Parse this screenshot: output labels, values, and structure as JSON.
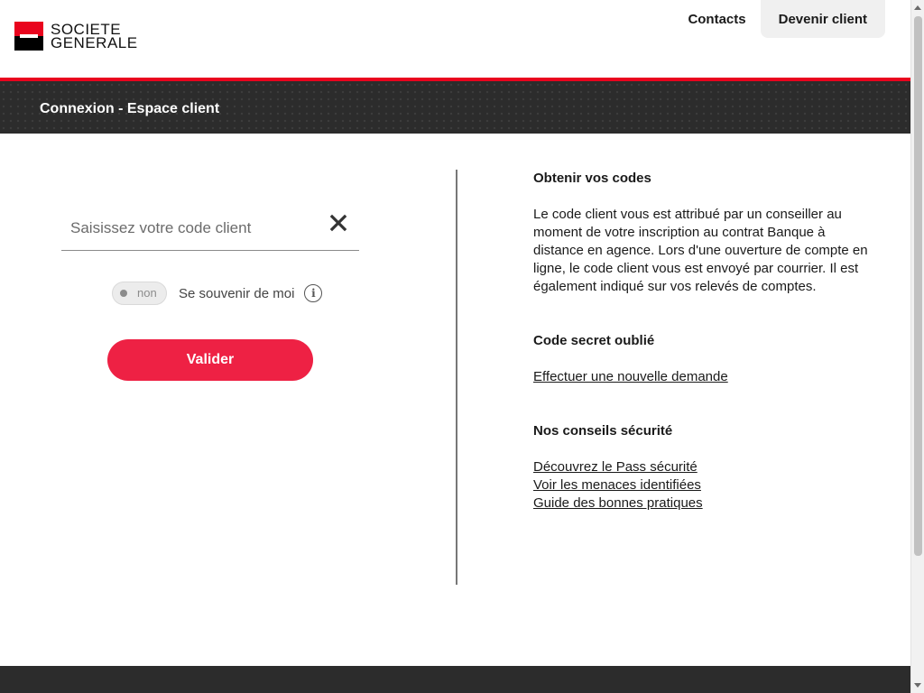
{
  "brand": {
    "line1": "SOCIETE",
    "line2": "GENERALE",
    "red": "#e9041e",
    "accent": "#ee2144"
  },
  "nav": {
    "contacts": "Contacts",
    "become_client": "Devenir client"
  },
  "banner": {
    "title": "Connexion - Espace client"
  },
  "login": {
    "code_placeholder": "Saisissez votre code client",
    "clear_icon": "close-icon",
    "toggle_state": "non",
    "remember_label": "Se souvenir de moi",
    "info_icon": "i",
    "submit_label": "Valider"
  },
  "help": {
    "codes_title": "Obtenir vos codes",
    "codes_text": "Le code client vous est attribué par un conseiller au moment de votre inscription au contrat Banque à distance en agence. Lors d'une ouverture de compte en ligne, le code client vous est envoyé par courrier. Il est également indiqué sur vos relevés de comptes.",
    "secret_title": "Code secret oublié",
    "secret_link": "Effectuer une nouvelle demande",
    "security_title": "Nos conseils sécurité",
    "security_links": [
      "Découvrez le Pass sécurité",
      "Voir les menaces identifiées",
      "Guide des bonnes pratiques"
    ]
  }
}
